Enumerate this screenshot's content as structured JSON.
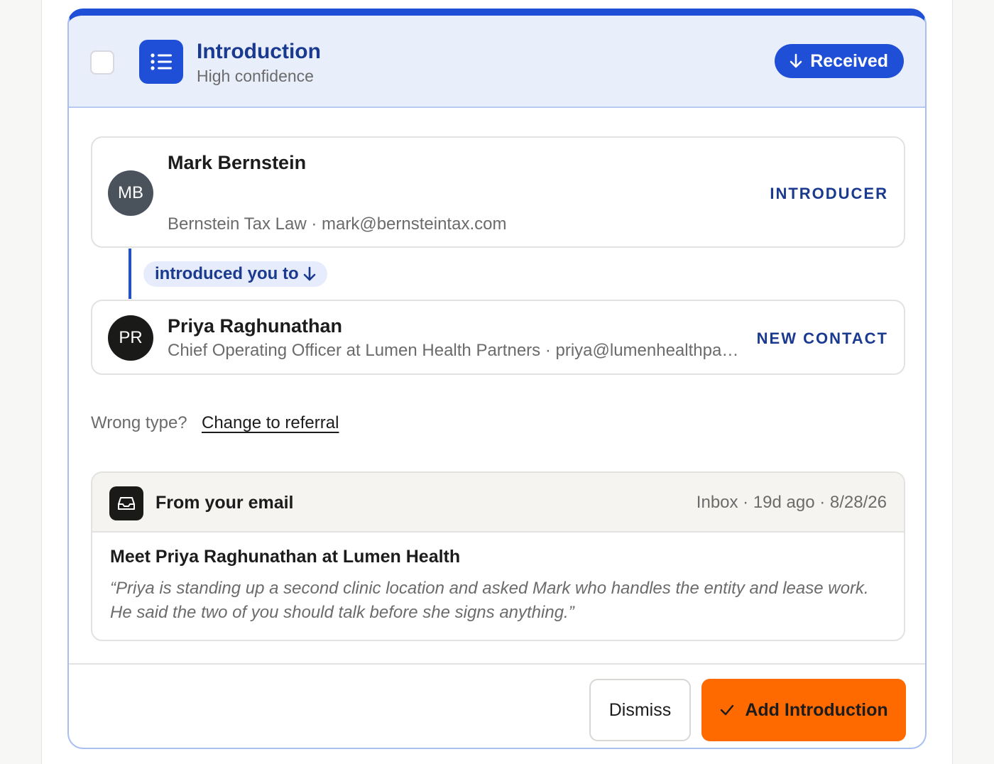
{
  "header": {
    "title": "Introduction",
    "subtitle": "High confidence",
    "status_label": "Received",
    "status_icon": "arrow-down-icon",
    "type_icon": "list-icon"
  },
  "introducer": {
    "initials": "MB",
    "name": "Mark Bernstein",
    "detail": "Bernstein Tax Law · mark@bernsteintax.com",
    "role": "INTRODUCER"
  },
  "connector": {
    "label": "introduced you to",
    "icon": "arrow-down-icon"
  },
  "contact": {
    "initials": "PR",
    "name": "Priya Raghunathan",
    "detail": "Chief Operating Officer at Lumen Health Partners · priya@lumenhealthpartners.com",
    "role": "NEW CONTACT"
  },
  "wrong_type": {
    "prompt": "Wrong type?",
    "link": "Change to referral"
  },
  "email": {
    "source": "From your email",
    "meta": "Inbox · 19d ago · 8/28/26",
    "subject": "Meet Priya Raghunathan at Lumen Health",
    "quote": "“Priya is standing up a second clinic location and asked Mark who handles the entity and lease work. He said the two of you should talk before she signs anything.”",
    "icon": "inbox-icon"
  },
  "actions": {
    "dismiss": "Dismiss",
    "add": "Add Introduction",
    "add_icon": "check-icon"
  },
  "colors": {
    "accent": "#1f4fd6",
    "title": "#1a3a8f",
    "primary_button": "#ff6a00"
  }
}
